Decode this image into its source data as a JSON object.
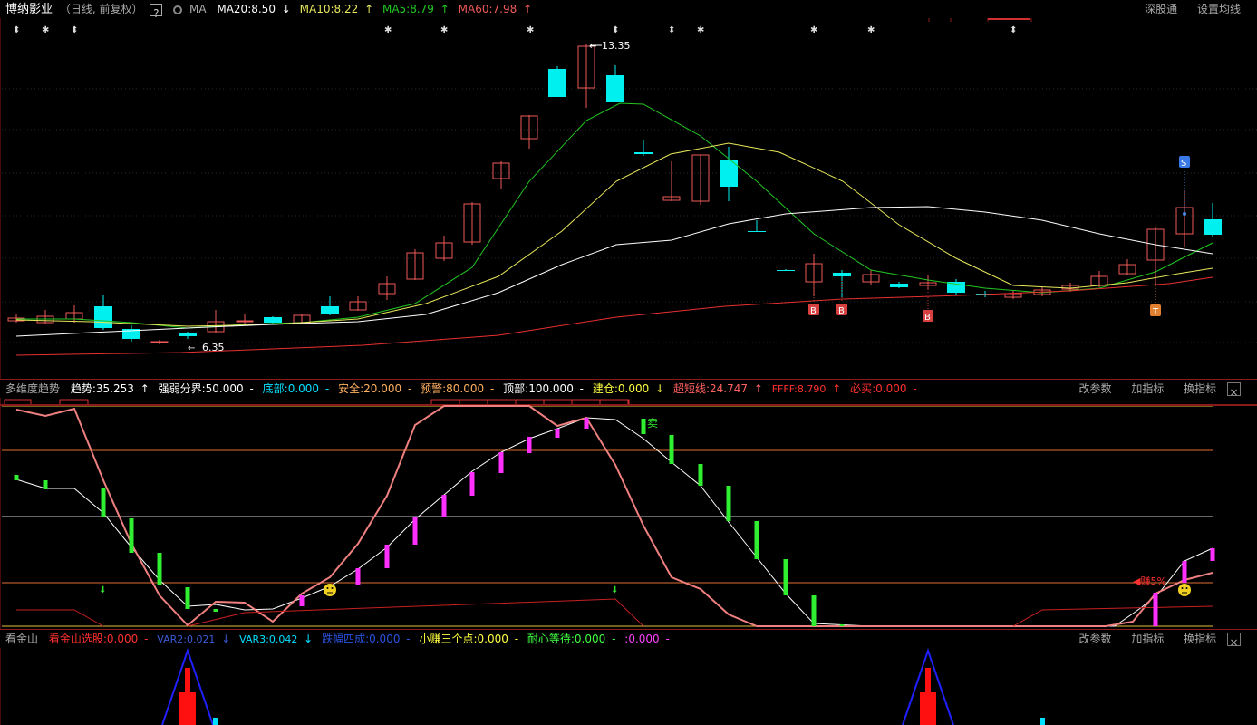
{
  "main_header": {
    "stock_name": "博纳影业",
    "period": "（日线, 前复权）",
    "help": "?",
    "indicator": "MA",
    "ma20": "MA20:8.50",
    "ma20_arrow": "↓",
    "ma10": "MA10:8.22",
    "ma10_arrow": "↑",
    "ma5": "MA5:8.79",
    "ma5_arrow": "↑",
    "ma60": "MA60:7.98",
    "ma60_arrow": "↑",
    "deep": "深股通",
    "set_ma": "设置均线"
  },
  "price_annotations": {
    "high": "13.35",
    "low": "6.35",
    "buy_mark": "B",
    "sell_mark": "S",
    "t_mark": "T"
  },
  "pane2_header": {
    "name": "多维度趋势",
    "trend": "趋势:35.253",
    "trend_arrow": "↑",
    "strong": "强弱分界:50.000",
    "strong_arrow": "-",
    "bottom": "底部:0.000",
    "bottom_arrow": "-",
    "safe": "安全:20.000",
    "safe_arrow": "-",
    "warn": "预警:80.000",
    "warn_arrow": "-",
    "top": "顶部:100.000",
    "top_arrow": "-",
    "build": "建仓:0.000",
    "build_arrow": "↓",
    "ultra": "超短线:24.747",
    "ultra_arrow": "↑",
    "ffff": "FFFF:8.790",
    "ffff_arrow": "↑",
    "must_buy": "必买:0.000",
    "must_buy_arrow": "-",
    "sell_label": "卖",
    "earn_label": "赚5%",
    "btn_params": "改参数",
    "btn_add": "加指标",
    "btn_switch": "换指标",
    "close": "×"
  },
  "pane3_header": {
    "name": "看金山",
    "s1": "看金山选股:0.000",
    "s1_arrow": "-",
    "s2": "VAR2:0.021",
    "s2_arrow": "↓",
    "s3": "VAR3:0.042",
    "s3_arrow": "↓",
    "s4": "跌幅四成:0.000",
    "s4_arrow": "-",
    "s5": "小赚三个点:0.000",
    "s5_arrow": "-",
    "s6": "耐心等待:0.000",
    "s6_arrow": "-",
    "s7": ":0.000",
    "s7_arrow": "-",
    "btn_params": "改参数",
    "btn_add": "加指标",
    "btn_switch": "换指标",
    "close": "×"
  },
  "colors": {
    "up": "#f05a5a",
    "down": "#00f0f0",
    "ma5": "#22c822",
    "ma10": "#e8e85a",
    "ma20": "#ffffff",
    "ma60": "#e83030"
  }
}
